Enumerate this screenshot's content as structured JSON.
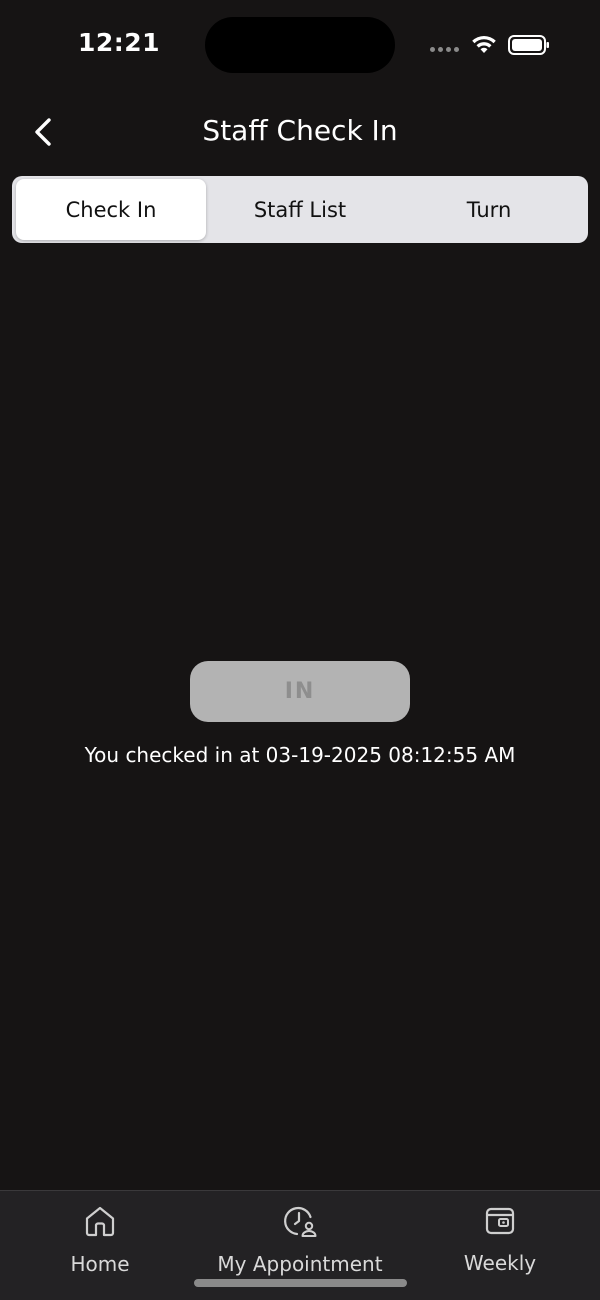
{
  "status_bar": {
    "time": "12:21"
  },
  "header": {
    "title": "Staff Check In"
  },
  "tabs": [
    {
      "label": "Check In",
      "active": true
    },
    {
      "label": "Staff List",
      "active": false
    },
    {
      "label": "Turn",
      "active": false
    }
  ],
  "check_in": {
    "button_label": "IN",
    "message": "You checked in at 03-19-2025 08:12:55 AM"
  },
  "tab_bar": {
    "items": [
      {
        "label": "Home",
        "icon": "home-icon"
      },
      {
        "label": "My Appointment",
        "icon": "clock-user-icon"
      },
      {
        "label": "Weekly",
        "icon": "wallet-icon"
      }
    ]
  },
  "colors": {
    "background": "#161414",
    "segment_bg": "#e4e4e8",
    "in_button_bg": "#b3b3b3",
    "tab_bar_bg": "#232224"
  }
}
